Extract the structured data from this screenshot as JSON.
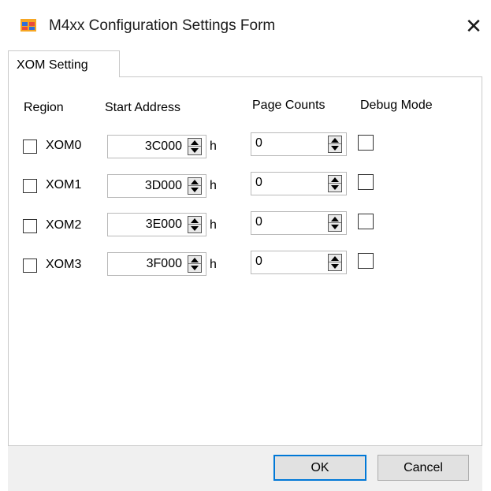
{
  "window": {
    "title": "M4xx Configuration Settings Form",
    "close_symbol": "✕",
    "icon": "app-window-icon"
  },
  "tabs": [
    {
      "label": "XOM Setting",
      "selected": true
    }
  ],
  "headers": {
    "region": "Region",
    "start_address": "Start Address",
    "page_counts": "Page Counts",
    "debug_mode": "Debug Mode"
  },
  "rows": [
    {
      "region": "XOM0",
      "checked": false,
      "address": "3C000",
      "unit": "h",
      "count": "0",
      "debug": false
    },
    {
      "region": "XOM1",
      "checked": false,
      "address": "3D000",
      "unit": "h",
      "count": "0",
      "debug": false
    },
    {
      "region": "XOM2",
      "checked": false,
      "address": "3E000",
      "unit": "h",
      "count": "0",
      "debug": false
    },
    {
      "region": "XOM3",
      "checked": false,
      "address": "3F000",
      "unit": "h",
      "count": "0",
      "debug": false
    }
  ],
  "buttons": {
    "ok": "OK",
    "cancel": "Cancel"
  },
  "colors": {
    "focus_border": "#0078d7",
    "button_face": "#e1e1e1",
    "footer_bg": "#f0f0f0"
  }
}
